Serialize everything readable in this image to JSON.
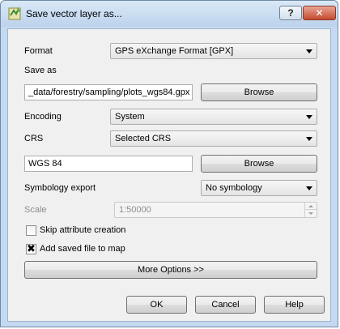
{
  "window": {
    "title": "Save vector layer as..."
  },
  "titlebar_buttons": {
    "help": "?",
    "close": "✕"
  },
  "format": {
    "label": "Format",
    "value": "GPS eXchange Format [GPX]"
  },
  "save_as": {
    "label": "Save as",
    "value": "_data/forestry/sampling/plots_wgs84.gpx",
    "browse": "Browse"
  },
  "encoding": {
    "label": "Encoding",
    "value": "System"
  },
  "crs": {
    "label": "CRS",
    "value": "Selected CRS",
    "crs_name": "WGS 84",
    "browse": "Browse"
  },
  "symbology": {
    "label": "Symbology export",
    "value": "No symbology"
  },
  "scale": {
    "label": "Scale",
    "value": "1:50000"
  },
  "skip_attr": {
    "label": "Skip attribute creation",
    "checked": false
  },
  "add_to_map": {
    "label": "Add saved file to map",
    "checked": true
  },
  "more_options": "More Options >>",
  "buttons": {
    "ok": "OK",
    "cancel": "Cancel",
    "help": "Help"
  }
}
